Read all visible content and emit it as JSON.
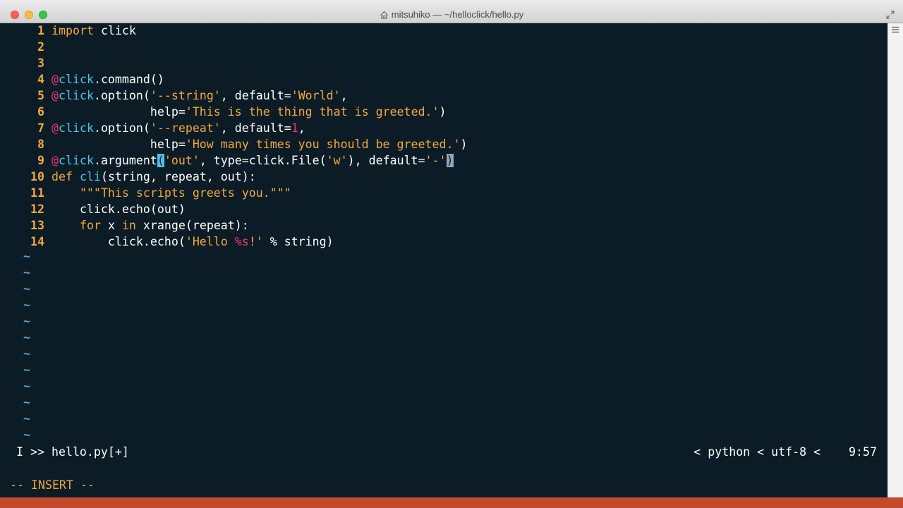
{
  "window": {
    "title": "mitsuhiko — ~/helloclick/hello.py"
  },
  "editor": {
    "lines": [
      {
        "n": "1"
      },
      {
        "n": "2"
      },
      {
        "n": "3"
      },
      {
        "n": "4"
      },
      {
        "n": "5"
      },
      {
        "n": "6"
      },
      {
        "n": "7"
      },
      {
        "n": "8"
      },
      {
        "n": "9"
      },
      {
        "n": "10"
      },
      {
        "n": "11"
      },
      {
        "n": "12"
      },
      {
        "n": "13"
      },
      {
        "n": "14"
      }
    ],
    "tokens": {
      "l1_import": "import",
      "l1_click": " click",
      "l4_at": "@",
      "l4_click": "click",
      "l4_rest": ".command()",
      "l5_at": "@",
      "l5_click": "click",
      "l5_a": ".option(",
      "l5_s1": "'--string'",
      "l5_b": ", default=",
      "l5_s2": "'World'",
      "l5_c": ",",
      "l6_a": "              help=",
      "l6_s": "'This is the thing that is greeted.'",
      "l6_b": ")",
      "l7_at": "@",
      "l7_click": "click",
      "l7_a": ".option(",
      "l7_s1": "'--repeat'",
      "l7_b": ", default=",
      "l7_num": "1",
      "l7_c": ",",
      "l8_a": "              help=",
      "l8_s": "'How many times you should be greeted.'",
      "l8_b": ")",
      "l9_at": "@",
      "l9_click": "click",
      "l9_a": ".argument",
      "l9_paren": "(",
      "l9_s1": "'out'",
      "l9_b": ", type=click.File(",
      "l9_s2": "'w'",
      "l9_c": "), default=",
      "l9_s3": "'-'",
      "l9_cursor": ")",
      "l10_def": "def",
      "l10_name": " cli",
      "l10_rest": "(string, repeat, out):",
      "l11_ind": "    ",
      "l11_doc": "\"\"\"This scripts greets you.\"\"\"",
      "l12_rest": "    click.echo(out)",
      "l13_ind": "    ",
      "l13_for": "for",
      "l13_x": " x ",
      "l13_in": "in",
      "l13_rest": " xrange(repeat):",
      "l14_a": "        click.echo(",
      "l14_s1": "'Hello ",
      "l14_fmt": "%s",
      "l14_s2": "!'",
      "l14_b": " % string)"
    },
    "empty_marker": "~"
  },
  "statusline": {
    "mode_letter": "I",
    "arrows": " >> ",
    "filename": "hello.py[+]",
    "right": "< python < utf-8 <    9:57"
  },
  "mode": "-- INSERT --",
  "colors": {
    "background": "#0b1c26",
    "keyword": "#f5a83b",
    "decorator": "#f0347c",
    "module": "#4cc3f0",
    "tilde": "#4ba4de"
  }
}
